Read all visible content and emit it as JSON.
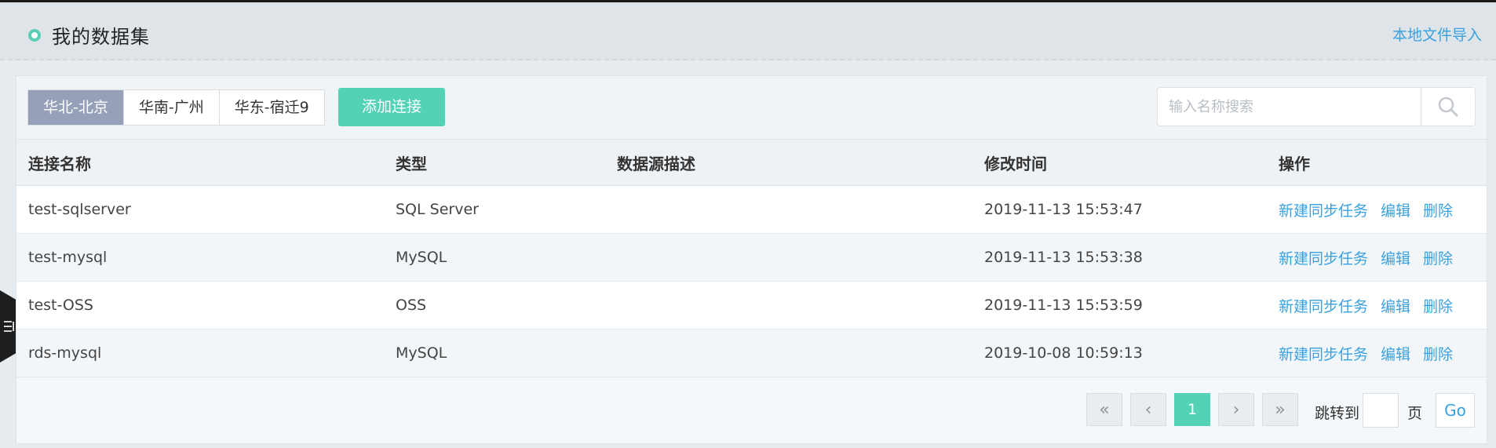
{
  "header": {
    "title": "我的数据集",
    "import_link": "本地文件导入"
  },
  "regions": [
    {
      "label": "华北-北京",
      "active": true
    },
    {
      "label": "华南-广州",
      "active": false
    },
    {
      "label": "华东-宿迁9",
      "active": false
    }
  ],
  "toolbar": {
    "add_button": "添加连接",
    "search_placeholder": "输入名称搜索"
  },
  "table": {
    "columns": [
      "连接名称",
      "类型",
      "数据源描述",
      "修改时间",
      "操作"
    ],
    "rows": [
      {
        "name": "test-sqlserver",
        "type": "SQL Server",
        "description": "",
        "modified": "2019-11-13 15:53:47"
      },
      {
        "name": "test-mysql",
        "type": "MySQL",
        "description": "",
        "modified": "2019-11-13 15:53:38"
      },
      {
        "name": "test-OSS",
        "type": "OSS",
        "description": "",
        "modified": "2019-11-13 15:53:59"
      },
      {
        "name": "rds-mysql",
        "type": "MySQL",
        "description": "",
        "modified": "2019-10-08 10:59:13"
      }
    ],
    "actions": [
      "新建同步任务",
      "编辑",
      "删除"
    ]
  },
  "pagination": {
    "first": "«",
    "prev": "‹",
    "current_page": "1",
    "next": "›",
    "last": "»",
    "jump_label": "跳转到",
    "page_unit": "页",
    "go_label": "Go"
  },
  "colors": {
    "accent": "#54d2b6",
    "link": "#3aa1e0",
    "active_tab": "#97a0b9"
  }
}
